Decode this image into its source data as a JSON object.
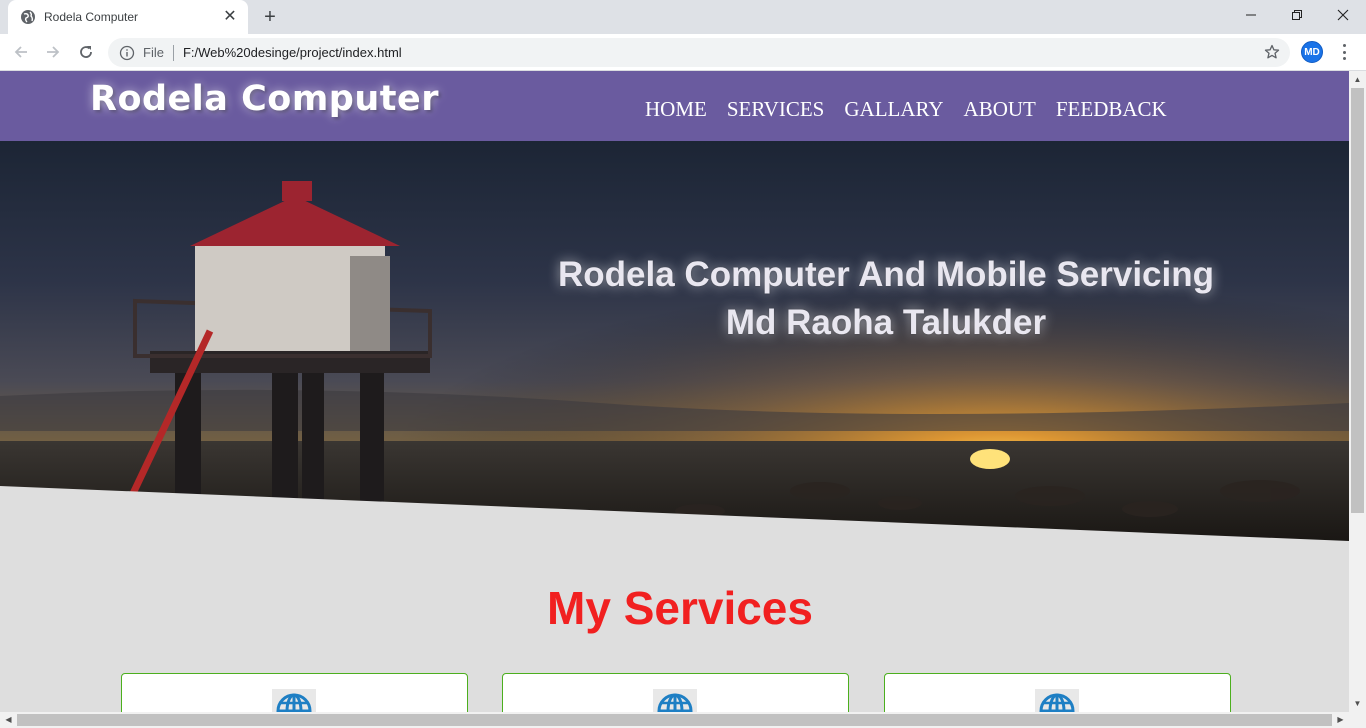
{
  "browser": {
    "tab_title": "Rodela Computer",
    "tab_close": "✕",
    "new_tab": "+",
    "scheme_label": "File",
    "url": "F:/Web%20desinge/project/index.html",
    "profile_initials": "MD",
    "window_controls": {
      "minimize": "—",
      "restore": "❐",
      "close": "✕"
    }
  },
  "site": {
    "logo": "Rodela Computer",
    "nav": [
      "HOME",
      "SERVICES",
      "GALLARY",
      "ABOUT",
      "FEEDBACK"
    ],
    "hero": {
      "line1": "Rodela Computer And Mobile Servicing",
      "line2": "Md Raoha Talukder"
    },
    "services_title": "My Services",
    "service_cards": [
      {
        "icon": "globe-icon"
      },
      {
        "icon": "globe-icon"
      },
      {
        "icon": "globe-icon"
      }
    ]
  },
  "colors": {
    "header_bg": "#6a5b9f",
    "page_bg": "#dedede",
    "services_title": "#f12020",
    "card_border": "#4caf1e",
    "globe": "#1e7fc4"
  }
}
